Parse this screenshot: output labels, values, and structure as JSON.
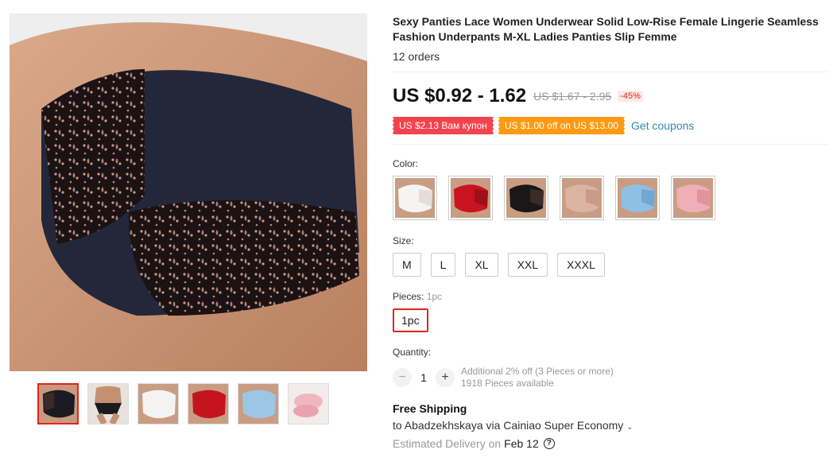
{
  "product": {
    "title": "Sexy Panties Lace Women Underwear Solid Low-Rise Female Lingerie Seamless Fashion Underpants M-XL Ladies Panties Slip Femme",
    "orders": "12 orders",
    "price": "US $0.92 - 1.62",
    "old_price": "US $1.67 - 2.95",
    "discount": "-45%"
  },
  "coupons": {
    "coupon1": "US $2.13 Вам купон",
    "coupon2": "US $1.00 off on US $13.00",
    "get_coupons": "Get coupons"
  },
  "color": {
    "label": "Color:",
    "options": [
      "white-lace",
      "red-lace",
      "black-lace",
      "nude-lace",
      "blue-lace",
      "pink-lace"
    ]
  },
  "size": {
    "label": "Size:",
    "options": [
      "M",
      "L",
      "XL",
      "XXL",
      "XXXL"
    ]
  },
  "pieces": {
    "label": "Pieces:",
    "selected_label": "1pc",
    "option": "1pc"
  },
  "quantity": {
    "label": "Quantity:",
    "minus": "−",
    "value": "1",
    "plus": "+",
    "promo": "Additional 2% off (3 Pieces or more)",
    "available": "1918 Pieces available"
  },
  "shipping": {
    "title": "Free Shipping",
    "to": "to Abadzekhskaya via Cainiao Super Economy",
    "chevron": "⌄",
    "delivery_label": "Estimated Delivery on",
    "delivery_date": "Feb 12",
    "help": "?"
  },
  "gallery": {
    "thumbnails": [
      "black-lace",
      "model-black",
      "white-lace",
      "red-lace",
      "blue-lace",
      "pink-lace-pack"
    ],
    "selected": 0
  },
  "colors": {
    "accent": "#e1251b",
    "coupon_red": "#f4434f",
    "coupon_orange": "#fd9a13",
    "link": "#2e8ba6"
  }
}
